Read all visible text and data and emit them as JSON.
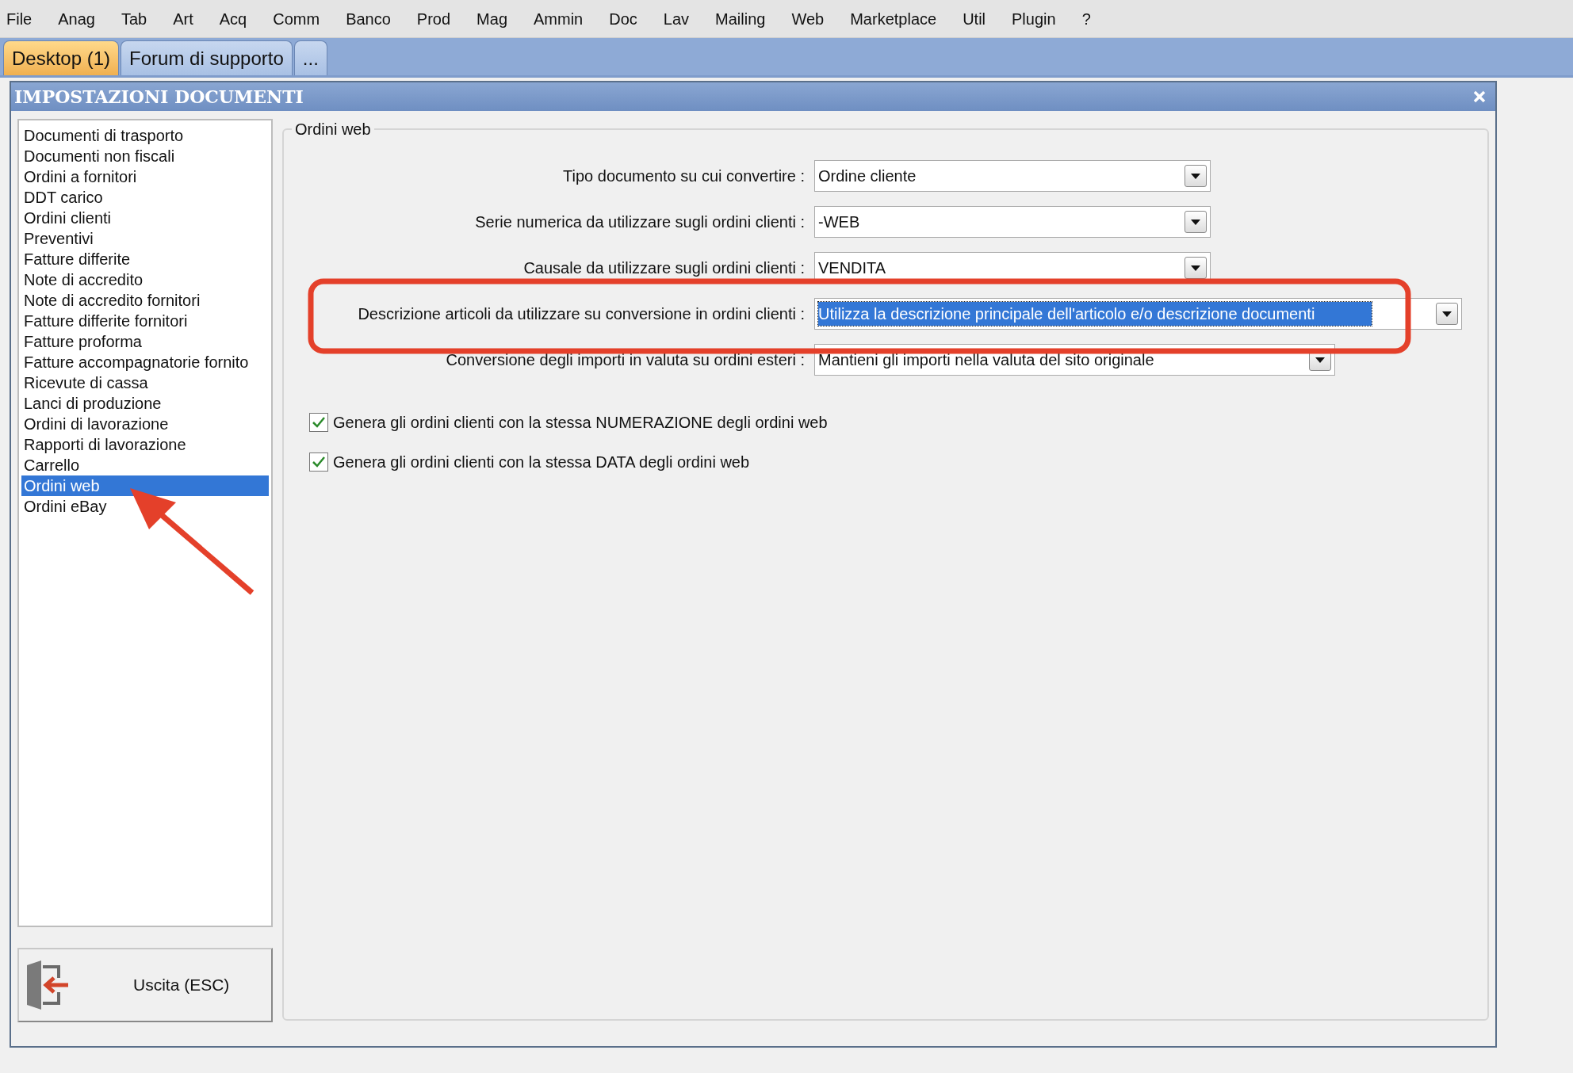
{
  "menu": [
    "File",
    "Anag",
    "Tab",
    "Art",
    "Acq",
    "Comm",
    "Banco",
    "Prod",
    "Mag",
    "Ammin",
    "Doc",
    "Lav",
    "Mailing",
    "Web",
    "Marketplace",
    "Util",
    "Plugin",
    "?"
  ],
  "tabs": [
    {
      "label": "Desktop (1)",
      "selected": true
    },
    {
      "label": "Forum di supporto",
      "selected": false
    },
    {
      "label": "...",
      "selected": false
    }
  ],
  "window": {
    "title": "IMPOSTAZIONI DOCUMENTI"
  },
  "sidebar": {
    "items": [
      {
        "label": "Documenti di trasporto",
        "selected": false
      },
      {
        "label": "Documenti non fiscali",
        "selected": false
      },
      {
        "label": "Ordini a fornitori",
        "selected": false
      },
      {
        "label": "DDT carico",
        "selected": false
      },
      {
        "label": "Ordini clienti",
        "selected": false
      },
      {
        "label": "Preventivi",
        "selected": false
      },
      {
        "label": "Fatture differite",
        "selected": false
      },
      {
        "label": "Note di accredito",
        "selected": false
      },
      {
        "label": "Note di accredito fornitori",
        "selected": false
      },
      {
        "label": "Fatture differite fornitori",
        "selected": false
      },
      {
        "label": "Fatture proforma",
        "selected": false
      },
      {
        "label": "Fatture accompagnatorie fornito",
        "selected": false
      },
      {
        "label": "Ricevute di cassa",
        "selected": false
      },
      {
        "label": "Lanci di produzione",
        "selected": false
      },
      {
        "label": "Ordini di lavorazione",
        "selected": false
      },
      {
        "label": "Rapporti di lavorazione",
        "selected": false
      },
      {
        "label": "Carrello",
        "selected": false
      },
      {
        "label": "Ordini web",
        "selected": true
      },
      {
        "label": "Ordini eBay",
        "selected": false
      }
    ]
  },
  "exit_button": {
    "label": "Uscita (ESC)"
  },
  "group": {
    "title": "Ordini web",
    "fields": [
      {
        "label": "Tipo documento su cui convertire :",
        "value": "Ordine cliente",
        "focused": false
      },
      {
        "label": "Serie numerica da utilizzare sugli ordini clienti :",
        "value": "-WEB",
        "focused": false
      },
      {
        "label": "Causale da utilizzare sugli ordini clienti :",
        "value": "VENDITA",
        "focused": false
      },
      {
        "label": "Descrizione articoli da utilizzare su conversione in ordini clienti :",
        "value": "Utilizza la descrizione principale dell'articolo e/o descrizione documenti",
        "focused": true
      },
      {
        "label": "Conversione degli importi in valuta su ordini esteri :",
        "value": "Mantieni gli importi nella valuta del sito originale",
        "focused": false
      }
    ],
    "checkboxes": [
      {
        "label": "Genera gli ordini clienti con la stessa NUMERAZIONE degli ordini web",
        "checked": true
      },
      {
        "label": "Genera gli ordini clienti con la stessa DATA degli ordini web",
        "checked": true
      }
    ]
  }
}
